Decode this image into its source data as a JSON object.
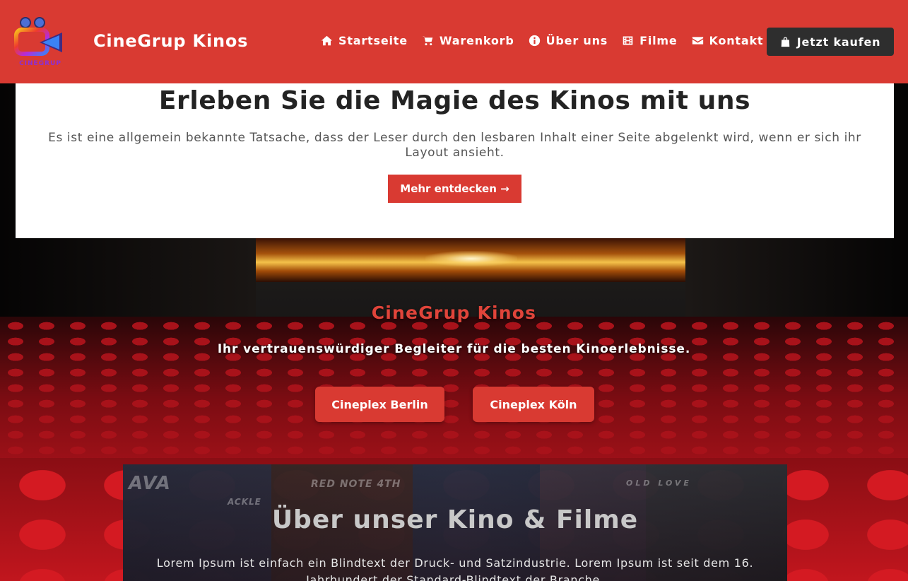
{
  "header": {
    "brand": "CineGrup Kinos",
    "logo_text": "CINEGRUP",
    "nav": [
      {
        "label": "Startseite",
        "icon": "home-icon"
      },
      {
        "label": "Warenkorb",
        "icon": "cart-icon"
      },
      {
        "label": "Über uns",
        "icon": "info-icon"
      },
      {
        "label": "Filme",
        "icon": "film-icon"
      },
      {
        "label": "Kontakt",
        "icon": "envelope-icon"
      }
    ],
    "buy_button": "Jetzt kaufen",
    "buy_icon": "shopping-bag-icon"
  },
  "hero": {
    "title": "Erleben Sie die Magie des Kinos mit uns",
    "text": "Es ist eine allgemein bekannte Tatsache, dass der Leser durch den lesbaren Inhalt einer Seite abgelenkt wird, wenn er sich ihr Layout ansieht.",
    "button": "Mehr entdecken →"
  },
  "cinema": {
    "title": "CineGrup Kinos",
    "subtitle": "Ihr vertrauenswürdiger Begleiter für die besten Kinoerlebnisse.",
    "locations": [
      "Cineplex Berlin",
      "Cineplex Köln"
    ]
  },
  "about": {
    "title": "Über unser Kino & Filme",
    "text": "Lorem Ipsum ist einfach ein Blindtext der Druck- und Satzindustrie. Lorem Ipsum ist seit dem 16. Jahrhundert der Standard-Blindtext der Branche.",
    "poster_tags": [
      "AVA",
      "RED NOTE 4TH",
      "ACKLE",
      "OLD LOVE"
    ]
  },
  "colors": {
    "accent": "#d93a32",
    "dark_button": "#2e2e2e"
  }
}
